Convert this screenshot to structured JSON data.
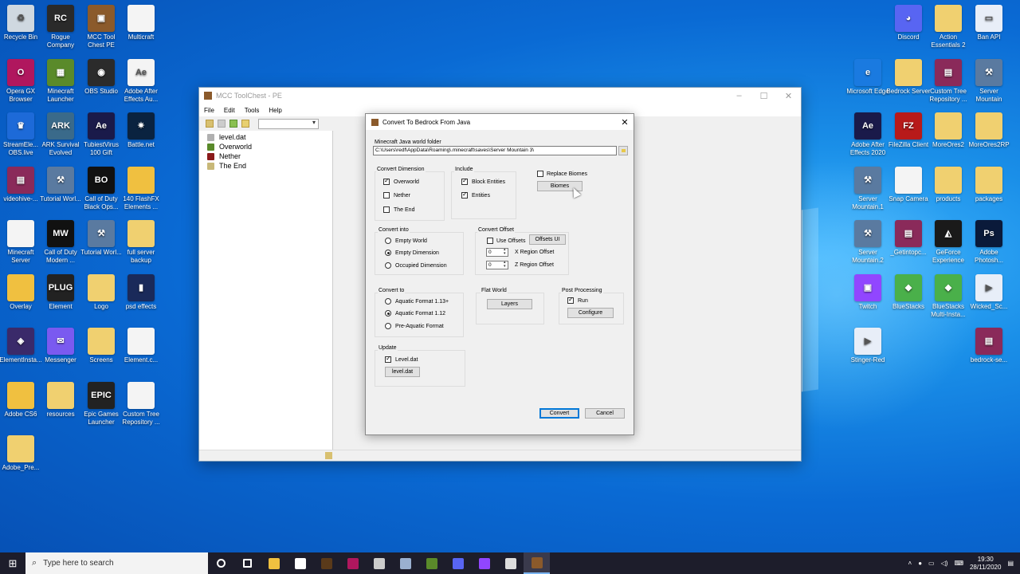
{
  "desktop": {
    "left_icons": [
      {
        "label": "Recycle Bin",
        "icon": "recycle-bin-icon",
        "color": "#cfd8e0",
        "glyph": "♻"
      },
      {
        "label": "Rogue Company",
        "icon": "rogue-company-icon",
        "color": "#2a2a2a",
        "glyph": "RC"
      },
      {
        "label": "MCC Tool Chest PE",
        "icon": "chest-icon",
        "color": "#8b5a2b",
        "glyph": "▣"
      },
      {
        "label": "Multicraft",
        "icon": "file-icon",
        "color": "#f4f4f4",
        "glyph": ""
      },
      {
        "label": "Opera GX Browser",
        "icon": "opera-icon",
        "color": "#b0175e",
        "glyph": "O"
      },
      {
        "label": "Minecraft Launcher",
        "icon": "minecraft-icon",
        "color": "#5a8a2a",
        "glyph": "▦"
      },
      {
        "label": "OBS Studio",
        "icon": "obs-icon",
        "color": "#2b2b2b",
        "glyph": "◉"
      },
      {
        "label": "Adobe After Effects Au...",
        "icon": "file-ae-icon",
        "color": "#f4f4f4",
        "glyph": "Ae"
      },
      {
        "label": "StreamEle... OBS.live",
        "icon": "streamelements-icon",
        "color": "#1d6ad8",
        "glyph": "♛"
      },
      {
        "label": "ARK Survival Evolved",
        "icon": "ark-icon",
        "color": "#3a6a8a",
        "glyph": "ARK"
      },
      {
        "label": "TubiestVirus 100 Gift",
        "icon": "after-effects-icon",
        "color": "#1a1a4a",
        "glyph": "Ae"
      },
      {
        "label": "Battle.net",
        "icon": "battlenet-icon",
        "color": "#0a2340",
        "glyph": "✷"
      },
      {
        "label": "videohive-...",
        "icon": "winrar-icon",
        "color": "#8a2a5a",
        "glyph": "▤"
      },
      {
        "label": "Tutorial Worl...",
        "icon": "shovel-icon",
        "color": "#5a7aa0",
        "glyph": "⚒"
      },
      {
        "label": "Call of Duty Black Ops...",
        "icon": "blackops-icon",
        "color": "#111",
        "glyph": "BO"
      },
      {
        "label": "140 FlashFX Elements ...",
        "icon": "folder-icon",
        "color": "#f0c040",
        "glyph": ""
      },
      {
        "label": "Minecraft Server",
        "icon": "file-icon",
        "color": "#f4f4f4",
        "glyph": ""
      },
      {
        "label": "Call of Duty Modern ...",
        "icon": "mw-icon",
        "color": "#111",
        "glyph": "MW"
      },
      {
        "label": "Tutorial Worl...",
        "icon": "shovel-icon",
        "color": "#5a7aa0",
        "glyph": "⚒"
      },
      {
        "label": "full server backup",
        "icon": "folder-zip-icon",
        "color": "#f0d070",
        "glyph": ""
      },
      {
        "label": "Overlay",
        "icon": "folder-icon",
        "color": "#f0c040",
        "glyph": ""
      },
      {
        "label": "Element",
        "icon": "plugin-icon",
        "color": "#222",
        "glyph": "PLUG"
      },
      {
        "label": "Logo",
        "icon": "folder-file-icon",
        "color": "#f0d070",
        "glyph": ""
      },
      {
        "label": "psd effects",
        "icon": "psd-icon",
        "color": "#1a2a5a",
        "glyph": "▮"
      },
      {
        "label": "ElementInsta...",
        "icon": "element-install-icon",
        "color": "#3a2a6a",
        "glyph": "◈"
      },
      {
        "label": "Messenger",
        "icon": "messenger-icon",
        "color": "#7a5af0",
        "glyph": "✉"
      },
      {
        "label": "Screens",
        "icon": "folder-file-icon",
        "color": "#f0d070",
        "glyph": ""
      },
      {
        "label": "Element.c...",
        "icon": "file-icon",
        "color": "#f4f4f4",
        "glyph": ""
      },
      {
        "label": "Adobe CS6",
        "icon": "folder-icon",
        "color": "#f0c040",
        "glyph": ""
      },
      {
        "label": "resources",
        "icon": "folder-file-icon",
        "color": "#f0d070",
        "glyph": ""
      },
      {
        "label": "Epic Games Launcher",
        "icon": "epic-icon",
        "color": "#222",
        "glyph": "EPIC"
      },
      {
        "label": "Custom Tree Repository ...",
        "icon": "file-icon",
        "color": "#f4f4f4",
        "glyph": ""
      },
      {
        "label": "Adobe_Pre...",
        "icon": "folder-zip-icon",
        "color": "#f0d070",
        "glyph": ""
      }
    ],
    "right_icons": [
      {
        "label": "Discord",
        "icon": "discord-icon",
        "color": "#5865f2",
        "glyph": "◕"
      },
      {
        "label": "Action Essentials 2",
        "icon": "folder-file-icon",
        "color": "#f0d070",
        "glyph": ""
      },
      {
        "label": "Ban API",
        "icon": "window-icon",
        "color": "#e8eef8",
        "glyph": "▭"
      },
      {
        "label": "Microsoft Edge",
        "icon": "edge-icon",
        "color": "#1a7ae0",
        "glyph": "e"
      },
      {
        "label": "Bedrock Server",
        "icon": "folder-file-icon",
        "color": "#f0d070",
        "glyph": ""
      },
      {
        "label": "Custom Tree Repository ...",
        "icon": "winrar-icon",
        "color": "#8a2a5a",
        "glyph": "▤"
      },
      {
        "label": "Server Mountain",
        "icon": "shovel-icon",
        "color": "#5a7aa0",
        "glyph": "⚒"
      },
      {
        "label": "Adobe After Effects 2020",
        "icon": "after-effects-icon",
        "color": "#1a1a4a",
        "glyph": "Ae"
      },
      {
        "label": "FileZilla Client",
        "icon": "filezilla-icon",
        "color": "#b81a1a",
        "glyph": "FZ"
      },
      {
        "label": "MoreOres2",
        "icon": "folder-zip-icon",
        "color": "#f0d070",
        "glyph": ""
      },
      {
        "label": "MoreOres2RP",
        "icon": "folder-zip-icon",
        "color": "#f0d070",
        "glyph": ""
      },
      {
        "label": "Server Mountain.1",
        "icon": "shovel-icon",
        "color": "#5a7aa0",
        "glyph": "⚒"
      },
      {
        "label": "Snap Camera",
        "icon": "file-icon",
        "color": "#f4f4f4",
        "glyph": ""
      },
      {
        "label": "products",
        "icon": "folder-file-icon",
        "color": "#f0d070",
        "glyph": ""
      },
      {
        "label": "packages",
        "icon": "folder-file-icon",
        "color": "#f0d070",
        "glyph": ""
      },
      {
        "label": "Server Mountain.2",
        "icon": "shovel-icon",
        "color": "#5a7aa0",
        "glyph": "⚒"
      },
      {
        "label": "_Getintopc...",
        "icon": "winrar-icon",
        "color": "#8a2a5a",
        "glyph": "▤"
      },
      {
        "label": "GeForce Experience",
        "icon": "geforce-icon",
        "color": "#1a1a1a",
        "glyph": "◭"
      },
      {
        "label": "Adobe Photosh...",
        "icon": "photoshop-icon",
        "color": "#0a1a3a",
        "glyph": "Ps"
      },
      {
        "label": "Twitch",
        "icon": "twitch-icon",
        "color": "#9146ff",
        "glyph": "▣"
      },
      {
        "label": "BlueStacks",
        "icon": "bluestacks-icon",
        "color": "#4ab04a",
        "glyph": "◆"
      },
      {
        "label": "BlueStacks Multi-Insta...",
        "icon": "bluestacks-multi-icon",
        "color": "#4ab04a",
        "glyph": "◆"
      },
      {
        "label": "Wicked_Sc...",
        "icon": "video-file-icon",
        "color": "#e8eef8",
        "glyph": "▶"
      },
      {
        "label": "Stinger-Red",
        "icon": "video-file-icon",
        "color": "#e8eef8",
        "glyph": "▶"
      },
      {
        "label": "bedrock-se...",
        "icon": "winrar-icon",
        "color": "#8a2a5a",
        "glyph": "▤"
      }
    ]
  },
  "app": {
    "title": "MCC ToolChest - PE",
    "menu": [
      "File",
      "Edit",
      "Tools",
      "Help"
    ],
    "tree": [
      {
        "label": "level.dat",
        "color": "#b0b0b0"
      },
      {
        "label": "Overworld",
        "color": "#5a8a2a"
      },
      {
        "label": "Nether",
        "color": "#8a1a1a"
      },
      {
        "label": "The End",
        "color": "#c8b878"
      }
    ]
  },
  "dialog": {
    "title": "Convert To Bedrock From Java",
    "world_folder_label": "Minecraft Java world folder",
    "world_folder_value": "C:\\Users\\redf\\AppData\\Roaming\\.minecraft\\saves\\Server Mountain 3\\",
    "convert_dimension": {
      "label": "Convert Dimension",
      "items": [
        {
          "label": "Overworld",
          "checked": true
        },
        {
          "label": "Nether",
          "checked": false
        },
        {
          "label": "The End",
          "checked": false
        }
      ]
    },
    "include": {
      "label": "Include",
      "items": [
        {
          "label": "Block Entities",
          "checked": true
        },
        {
          "label": "Entities",
          "checked": true
        }
      ]
    },
    "replace_biomes": {
      "label": "Replace Biomes",
      "checked": false,
      "button": "Biomes"
    },
    "convert_into": {
      "label": "Convert into",
      "options": [
        {
          "label": "Empty World",
          "selected": false
        },
        {
          "label": "Empty Dimension",
          "selected": true
        },
        {
          "label": "Occupied Dimension",
          "selected": false
        }
      ]
    },
    "convert_offset": {
      "label": "Convert Offset",
      "use_offsets_label": "Use Offsets",
      "use_offsets_checked": false,
      "offsets_ui_button": "Offsets UI",
      "x_value": "0",
      "x_label": "X Region Offset",
      "z_value": "0",
      "z_label": "Z Region Offset"
    },
    "convert_to": {
      "label": "Convert to",
      "options": [
        {
          "label": "Aquatic Format 1.13+",
          "selected": false
        },
        {
          "label": "Aquatic Format 1.12",
          "selected": true
        },
        {
          "label": "Pre-Aquatic Format",
          "selected": false
        }
      ]
    },
    "flat_world": {
      "label": "Flat World",
      "button": "Layers"
    },
    "post_processing": {
      "label": "Post Processing",
      "run_label": "Run",
      "run_checked": true,
      "button": "Configure"
    },
    "update": {
      "label": "Update",
      "leveldat_label": "Level.dat",
      "leveldat_checked": true,
      "button": "level.dat"
    },
    "convert_button": "Convert",
    "cancel_button": "Cancel"
  },
  "taskbar": {
    "search_placeholder": "Type here to search",
    "apps": [
      {
        "name": "task-view-icon",
        "color": "#ffffff"
      },
      {
        "name": "timeline-icon",
        "color": "#ffffff"
      },
      {
        "name": "file-explorer-icon",
        "color": "#f0c040"
      },
      {
        "name": "store-icon",
        "color": "#ffffff"
      },
      {
        "name": "minecraft-icon",
        "color": "#5a3a1a"
      },
      {
        "name": "opera-icon",
        "color": "#b0175e"
      },
      {
        "name": "obs-icon",
        "color": "#cccccc"
      },
      {
        "name": "shovel-icon",
        "color": "#9ab0d0"
      },
      {
        "name": "minecraft-grass-icon",
        "color": "#5a8a2a"
      },
      {
        "name": "discord-icon",
        "color": "#5865f2"
      },
      {
        "name": "twitch-icon",
        "color": "#9146ff"
      },
      {
        "name": "snap-icon",
        "color": "#dddddd"
      },
      {
        "name": "chest-icon",
        "color": "#8b5a2b"
      }
    ],
    "time": "19:30",
    "date": "28/11/2020"
  }
}
